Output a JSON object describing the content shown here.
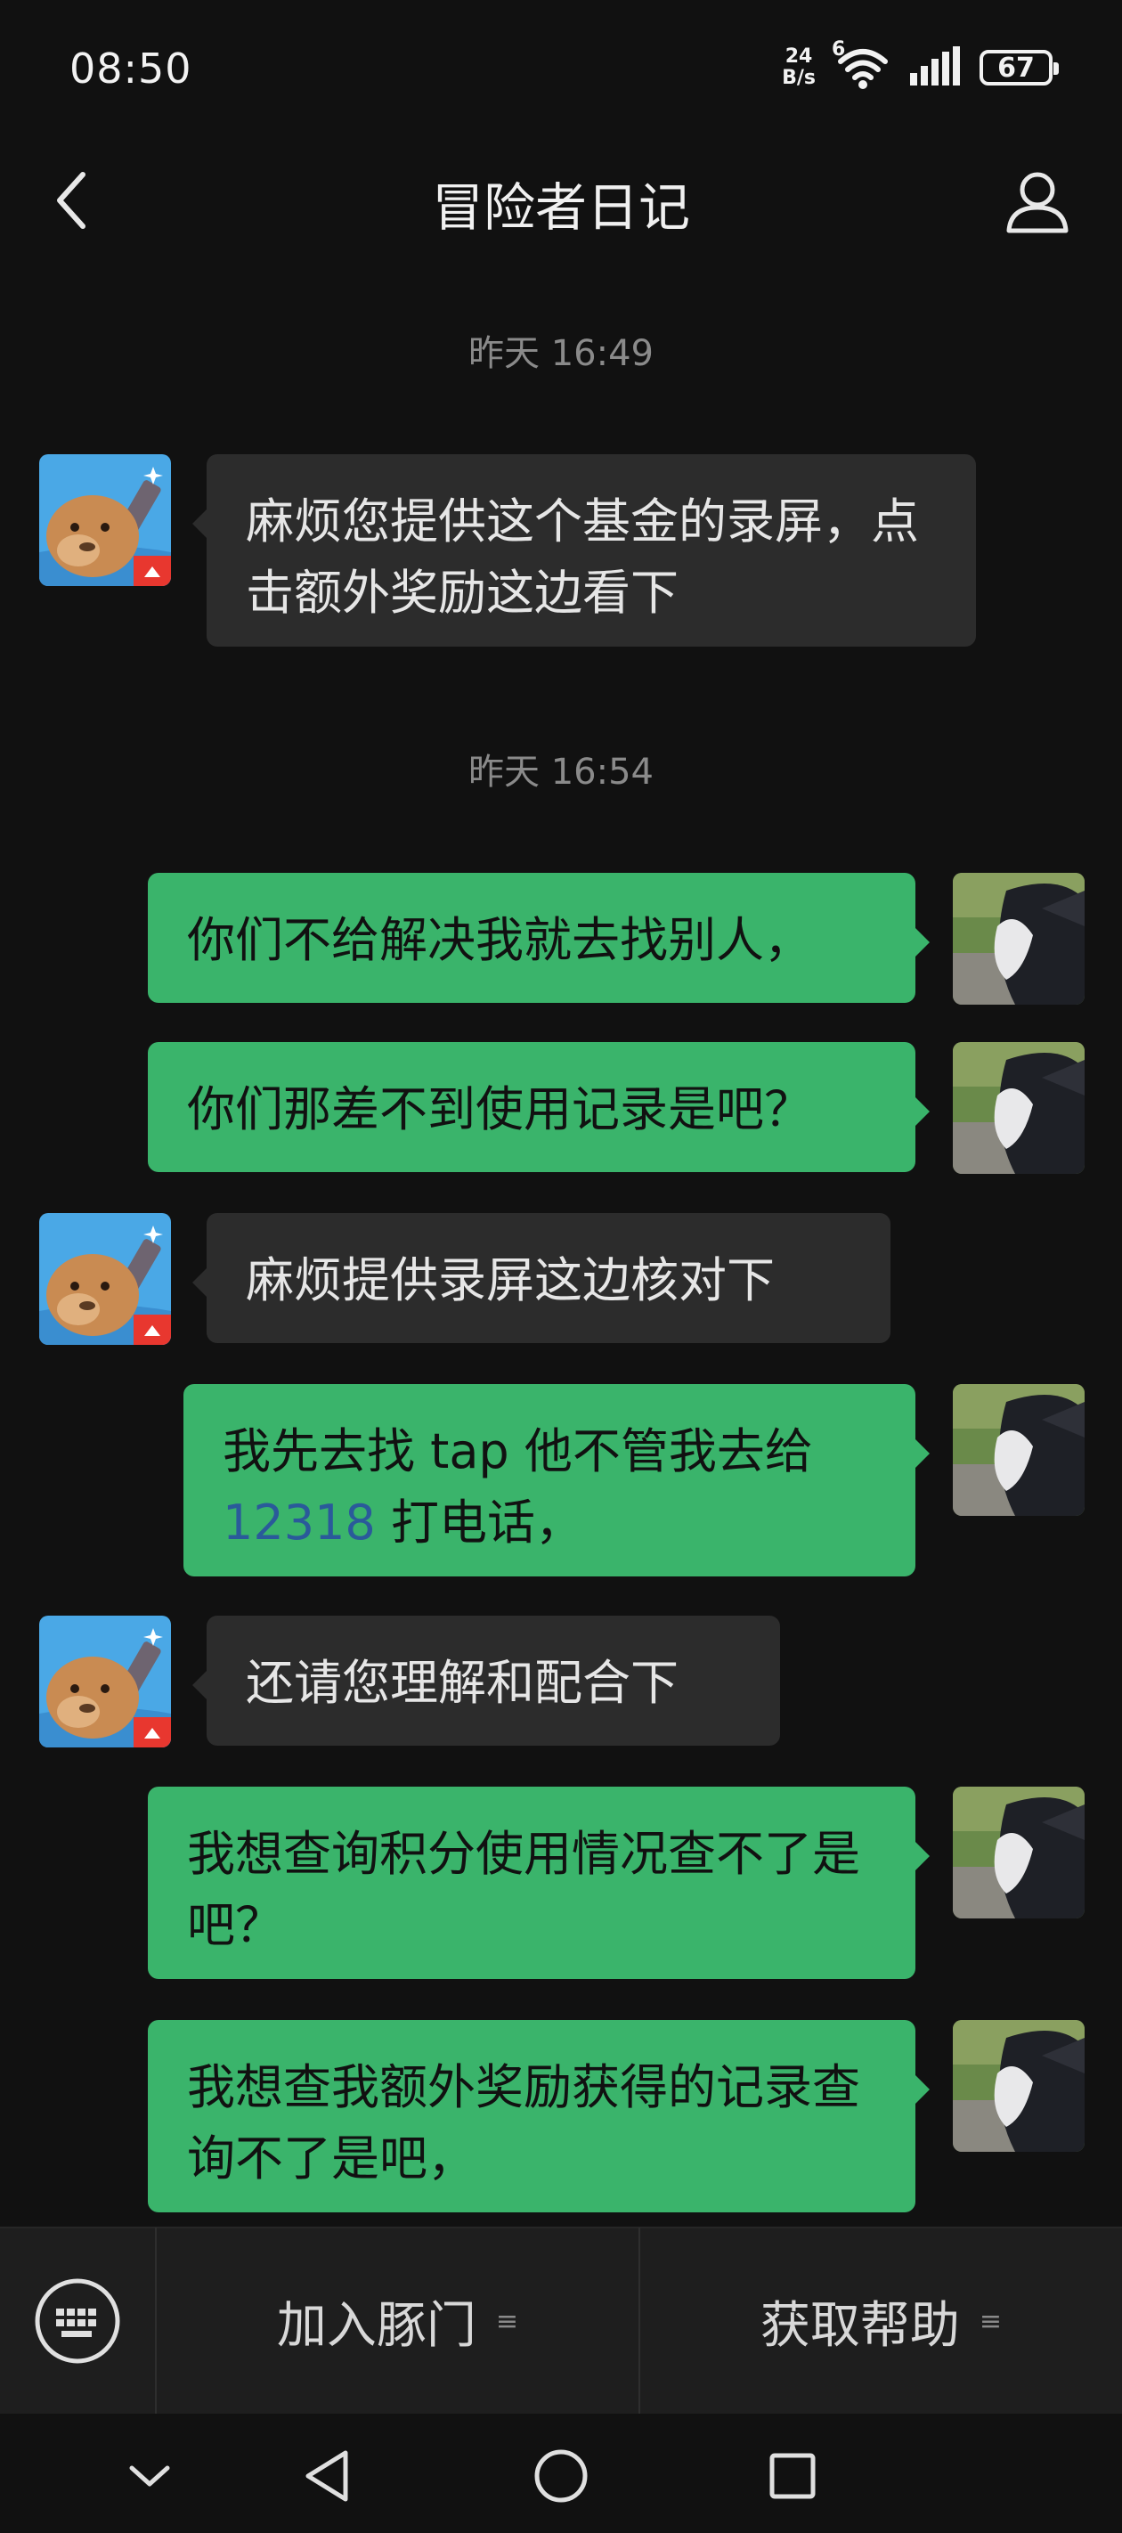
{
  "status_bar": {
    "time": "08:50",
    "net_speed_value": "24",
    "net_speed_unit": "B/s",
    "wifi_badge": "6",
    "battery": "67"
  },
  "header": {
    "title": "冒险者日记"
  },
  "messages": [
    {
      "kind": "timestamp",
      "text": "昨天 16:49"
    },
    {
      "kind": "incoming",
      "text": "麻烦您提供这个基金的录屏，点击额外奖励这边看下"
    },
    {
      "kind": "timestamp",
      "text": "昨天 16:54"
    },
    {
      "kind": "outgoing",
      "text": "你们不给解决我就去找别人，"
    },
    {
      "kind": "outgoing",
      "text": "你们那差不到使用记录是吧？"
    },
    {
      "kind": "incoming",
      "text": "麻烦提供录屏这边核对下"
    },
    {
      "kind": "outgoing",
      "text_before": "我先去找 tap 他不管我去给",
      "link": "12318",
      "text_after": " 打电话，"
    },
    {
      "kind": "incoming",
      "text": "还请您理解和配合下"
    },
    {
      "kind": "outgoing",
      "text": "我想查询积分使用情况查不了是吧？"
    },
    {
      "kind": "outgoing",
      "text": "我想查我额外奖励获得的记录查询不了是吧，"
    }
  ],
  "bottom_bar": {
    "keyboard_icon": "keyboard-icon",
    "menu_1": "加入豚门",
    "menu_2": "获取帮助",
    "menu_marker": "≡"
  },
  "colors": {
    "background": "#111111",
    "incoming_bubble": "#2c2c2c",
    "outgoing_bubble": "#3ab46b",
    "link": "#2a5a9a"
  }
}
